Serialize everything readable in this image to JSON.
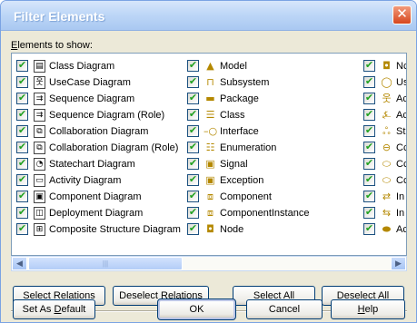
{
  "window": {
    "title": "Filter Elements",
    "close_label": "✕"
  },
  "elements_label": {
    "prefix": "",
    "accel": "E",
    "rest": "lements to show:"
  },
  "columns": [
    [
      {
        "label": "Class Diagram",
        "icon": "class-diagram-icon",
        "glyph": "▤",
        "kind": "diagram"
      },
      {
        "label": "UseCase Diagram",
        "icon": "usecase-diagram-icon",
        "glyph": "웃",
        "kind": "diagram"
      },
      {
        "label": "Sequence Diagram",
        "icon": "sequence-diagram-icon",
        "glyph": "⇉",
        "kind": "diagram"
      },
      {
        "label": "Sequence Diagram (Role)",
        "icon": "sequence-role-diagram-icon",
        "glyph": "⇉",
        "kind": "diagram"
      },
      {
        "label": "Collaboration Diagram",
        "icon": "collaboration-diagram-icon",
        "glyph": "⧉",
        "kind": "diagram"
      },
      {
        "label": "Collaboration Diagram (Role)",
        "icon": "collaboration-role-diagram-icon",
        "glyph": "⧉",
        "kind": "diagram"
      },
      {
        "label": "Statechart Diagram",
        "icon": "statechart-diagram-icon",
        "glyph": "◔",
        "kind": "diagram"
      },
      {
        "label": "Activity Diagram",
        "icon": "activity-diagram-icon",
        "glyph": "▭",
        "kind": "diagram"
      },
      {
        "label": "Component Diagram",
        "icon": "component-diagram-icon",
        "glyph": "▣",
        "kind": "diagram"
      },
      {
        "label": "Deployment Diagram",
        "icon": "deployment-diagram-icon",
        "glyph": "◫",
        "kind": "diagram"
      },
      {
        "label": "Composite Structure Diagram",
        "icon": "composite-structure-diagram-icon",
        "glyph": "⊞",
        "kind": "diagram"
      }
    ],
    [
      {
        "label": "Model",
        "icon": "model-icon",
        "glyph": "▲",
        "kind": "yellow"
      },
      {
        "label": "Subsystem",
        "icon": "subsystem-icon",
        "glyph": "⊓",
        "kind": "yellow"
      },
      {
        "label": "Package",
        "icon": "package-icon",
        "glyph": "▬",
        "kind": "yellow"
      },
      {
        "label": "Class",
        "icon": "class-icon",
        "glyph": "☰",
        "kind": "yellow"
      },
      {
        "label": "Interface",
        "icon": "interface-icon",
        "glyph": "–○",
        "kind": "yellow"
      },
      {
        "label": "Enumeration",
        "icon": "enumeration-icon",
        "glyph": "☷",
        "kind": "yellow"
      },
      {
        "label": "Signal",
        "icon": "signal-icon",
        "glyph": "▣",
        "kind": "yellow"
      },
      {
        "label": "Exception",
        "icon": "exception-icon",
        "glyph": "▣",
        "kind": "yellow"
      },
      {
        "label": "Component",
        "icon": "component-icon",
        "glyph": "⧈",
        "kind": "yellow"
      },
      {
        "label": "ComponentInstance",
        "icon": "component-instance-icon",
        "glyph": "⧈",
        "kind": "yellow"
      },
      {
        "label": "Node",
        "icon": "node-icon",
        "glyph": "◘",
        "kind": "yellow"
      }
    ],
    [
      {
        "label": "Nc",
        "icon": "node-instance-icon",
        "glyph": "◘",
        "kind": "yellow"
      },
      {
        "label": "Us",
        "icon": "usecase-icon",
        "glyph": "◯",
        "kind": "yellow"
      },
      {
        "label": "Ac",
        "icon": "actor-icon",
        "glyph": "웃",
        "kind": "yellow"
      },
      {
        "label": "Ac",
        "icon": "actor-role-icon",
        "glyph": "⍼",
        "kind": "yellow"
      },
      {
        "label": "St",
        "icon": "state-icon",
        "glyph": "ஃ",
        "kind": "yellow"
      },
      {
        "label": "Cc",
        "icon": "collaboration-icon",
        "glyph": "⊖",
        "kind": "yellow"
      },
      {
        "label": "Cc",
        "icon": "collaboration-occurrence-icon",
        "glyph": "⬭",
        "kind": "yellow"
      },
      {
        "label": "Cc",
        "icon": "collaboration-role-icon",
        "glyph": "⬭",
        "kind": "yellow"
      },
      {
        "label": "In",
        "icon": "interaction-icon",
        "glyph": "⇄",
        "kind": "yellow"
      },
      {
        "label": "In",
        "icon": "interaction-instance-icon",
        "glyph": "⇆",
        "kind": "yellow"
      },
      {
        "label": "Ac",
        "icon": "activity-icon",
        "glyph": "⬬",
        "kind": "yellow"
      }
    ]
  ],
  "checked_mark": "✔",
  "scrollbar": {
    "left_arrow": "◀",
    "right_arrow": "▶",
    "thumb_grip": "|||"
  },
  "buttons": {
    "select_relations": {
      "before": "Select ",
      "accel": "R",
      "after": "elations"
    },
    "deselect_relations": {
      "before": "Deselect Relatio",
      "accel": "n",
      "after": "s"
    },
    "select_all": {
      "before": "Select ",
      "accel": "A",
      "after": "ll"
    },
    "deselect_all": {
      "before": "D",
      "accel": "e",
      "after": "select All"
    },
    "set_default": {
      "before": "Set As ",
      "accel": "D",
      "after": "efault"
    },
    "ok": {
      "label": "OK"
    },
    "cancel": {
      "label": "Cancel"
    },
    "help": {
      "before": "",
      "accel": "H",
      "after": "elp"
    }
  }
}
